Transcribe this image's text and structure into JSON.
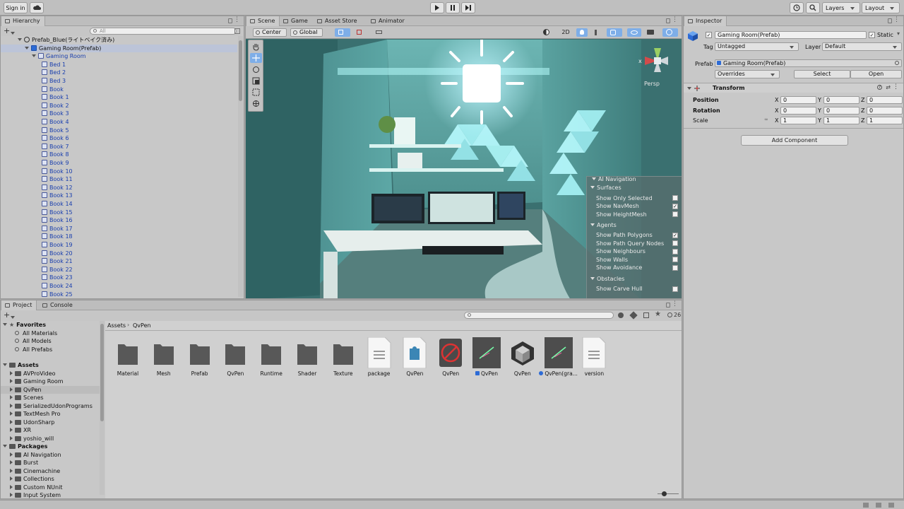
{
  "toolbar": {
    "sign_in": "Sign in",
    "layers": "Layers",
    "layout": "Layout"
  },
  "hierarchy": {
    "tab": "Hierarchy",
    "search_placeholder": "All",
    "scene_root": "Prefab_Blue(ライトベイク済み)",
    "prefab_root": "Gaming Room(Prefab)",
    "group": "Gaming Room",
    "items": [
      "Bed 1",
      "Bed 2",
      "Bed 3",
      "Book",
      "Book 1",
      "Book 2",
      "Book 3",
      "Book 4",
      "Book 5",
      "Book 6",
      "Book 7",
      "Book 8",
      "Book 9",
      "Book 10",
      "Book 11",
      "Book 12",
      "Book 13",
      "Book 14",
      "Book 15",
      "Book 16",
      "Book 17",
      "Book 18",
      "Book 19",
      "Book 20",
      "Book 21",
      "Book 22",
      "Book 23",
      "Book 24",
      "Book 25"
    ]
  },
  "scene_tabs": [
    "Scene",
    "Game",
    "Asset Store",
    "Animator"
  ],
  "scene_toolbar": {
    "pivot": "Center",
    "space": "Global",
    "mode_2d": "2D"
  },
  "gizmo": {
    "persp": "Persp",
    "x_label": "x"
  },
  "ai_navigation": {
    "title": "AI Navigation",
    "surfaces_header": "Surfaces",
    "surfaces": [
      {
        "label": "Show Only Selected",
        "checked": false
      },
      {
        "label": "Show NavMesh",
        "checked": true
      },
      {
        "label": "Show HeightMesh",
        "checked": false
      }
    ],
    "agents_header": "Agents",
    "agents": [
      {
        "label": "Show Path Polygons",
        "checked": true
      },
      {
        "label": "Show Path Query Nodes",
        "checked": false
      },
      {
        "label": "Show Neighbours",
        "checked": false
      },
      {
        "label": "Show Walls",
        "checked": false
      },
      {
        "label": "Show Avoidance",
        "checked": false
      }
    ],
    "obstacles_header": "Obstacles",
    "obstacles": [
      {
        "label": "Show Carve Hull",
        "checked": false
      }
    ]
  },
  "inspector": {
    "tab": "Inspector",
    "object_name": "Gaming Room(Prefab)",
    "static_label": "Static",
    "tag_label": "Tag",
    "tag_value": "Untagged",
    "layer_label": "Layer",
    "layer_value": "Default",
    "prefab_label": "Prefab",
    "prefab_value": "Gaming Room(Prefab)",
    "overrides": "Overrides",
    "select": "Select",
    "open": "Open",
    "transform_title": "Transform",
    "position_label": "Position",
    "rotation_label": "Rotation",
    "scale_label": "Scale",
    "position": {
      "x": "0",
      "y": "0",
      "z": "0"
    },
    "rotation": {
      "x": "0",
      "y": "0",
      "z": "0"
    },
    "scale": {
      "x": "1",
      "y": "1",
      "z": "1"
    },
    "axis_x": "X",
    "axis_y": "Y",
    "axis_z": "Z",
    "add_component": "Add Component"
  },
  "project": {
    "tabs": [
      "Project",
      "Console"
    ],
    "hidden_count": "26",
    "breadcrumb_root": "Assets",
    "breadcrumb_current": "QvPen",
    "favorites_header": "Favorites",
    "favorites": [
      "All Materials",
      "All Models",
      "All Prefabs"
    ],
    "assets_header": "Assets",
    "assets": [
      "AVProVideo",
      "Gaming Room",
      "QvPen",
      "Scenes",
      "SerializedUdonPrograms",
      "TextMesh Pro",
      "UdonSharp",
      "XR",
      "yoshio_will"
    ],
    "packages_header": "Packages",
    "packages": [
      "AI Navigation",
      "Burst",
      "Cinemachine",
      "Collections",
      "Custom NUnit",
      "Input System"
    ],
    "grid": [
      {
        "name": "Material",
        "kind": "folder"
      },
      {
        "name": "Mesh",
        "kind": "folder"
      },
      {
        "name": "Prefab",
        "kind": "folder"
      },
      {
        "name": "QvPen",
        "kind": "folder"
      },
      {
        "name": "Runtime",
        "kind": "folder"
      },
      {
        "name": "Shader",
        "kind": "folder"
      },
      {
        "name": "Texture",
        "kind": "folder"
      },
      {
        "name": "package",
        "kind": "doc"
      },
      {
        "name": "QvPen",
        "kind": "asmdef"
      },
      {
        "name": "QvPen",
        "kind": "udon"
      },
      {
        "name": "QvPen",
        "kind": "prefab"
      },
      {
        "name": "QvPen",
        "kind": "unity"
      },
      {
        "name": "QvPen(gra...",
        "kind": "prefab"
      },
      {
        "name": "version",
        "kind": "doc"
      }
    ]
  },
  "colors": {
    "selection": "#bcc4d8",
    "scene_teal": "#4e9d9b",
    "accent_blue": "#2d6bd6"
  }
}
